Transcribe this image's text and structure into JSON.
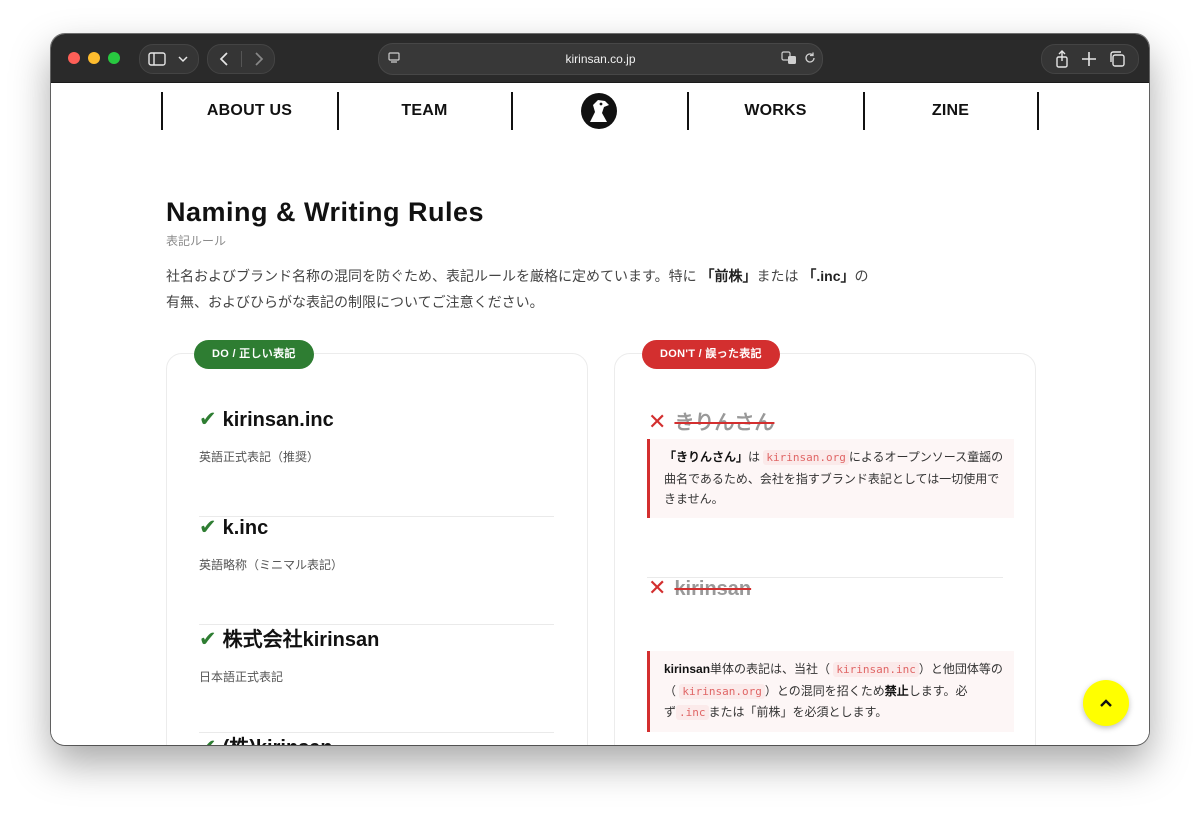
{
  "browser": {
    "url": "kirinsan.co.jp",
    "icons": [
      "sidebar-icon",
      "chevron-down-icon",
      "back-icon",
      "forward-icon",
      "page-icon",
      "translate-icon",
      "reload-icon",
      "share-icon",
      "new-tab-icon",
      "tabs-icon"
    ]
  },
  "nav": {
    "items": [
      "ABOUT US",
      "TEAM",
      "WORKS",
      "ZINE"
    ]
  },
  "page": {
    "title": "Naming & Writing Rules",
    "subtitle": "表記ルール",
    "intro_1": "社名およびブランド名称の混同を防ぐため、表記ルールを厳格に定めています。特に",
    "intro_b1": "「前株」",
    "intro_2": "または",
    "intro_b2": "「.inc」",
    "intro_3": "の",
    "intro_4": "有無、およびひらがな表記の制限についてご注意ください。"
  },
  "do": {
    "tag": "DO / 正しい表記",
    "check": "✔",
    "items": [
      {
        "label": "kirinsan.inc",
        "note": "英語正式表記（推奨）"
      },
      {
        "label": "k.inc",
        "note": "英語略称（ミニマル表記）"
      },
      {
        "label": "株式会社kirinsan",
        "note": "日本語正式表記"
      },
      {
        "label": "(株)kirinsan",
        "note": ""
      }
    ]
  },
  "dont": {
    "tag": "DON'T / 誤った表記",
    "x": "✕",
    "item1": {
      "label": "きりんさん",
      "t1": "「きりんさん」",
      "t2": "は",
      "code1": "kirinsan.org",
      "t3": "によるオープンソース童謡の曲名であるため、会社を指すブランド表記としては一切使用できません。"
    },
    "item2": {
      "label": "kirinsan",
      "t1": "kirinsan",
      "t2": "単体の表記は、当社（",
      "code1": "kirinsan.inc",
      "t3": "）と他団体等の（",
      "code2": "kirinsan.org",
      "t4": "）との混同を招くため",
      "t5": "禁止",
      "t6": "します。必ず",
      "code3": ".inc",
      "t7": "または「前株」を必須とします。"
    }
  },
  "fab": {
    "icon": "chevron-up-icon",
    "glyph": "⌃"
  },
  "colors": {
    "do": "#2e7d32",
    "dont": "#d32f2f",
    "fab": "#ffff00"
  }
}
